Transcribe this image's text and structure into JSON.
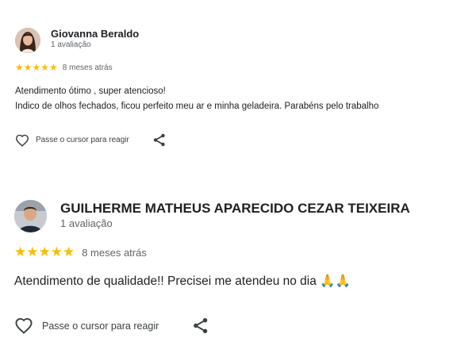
{
  "reviews": [
    {
      "author": "Giovanna Beraldo",
      "review_count": "1 avaliação",
      "stars": "★★★★★",
      "rating": 5,
      "date": "8 meses atrás",
      "text_lines": [
        "Atendimento ótimo , super atencioso!",
        "Indico de olhos fechados, ficou perfeito meu ar e minha geladeira. Parabéns pelo trabalho"
      ],
      "react_label": "Passe o cursor para reagir"
    },
    {
      "author": "GUILHERME MATHEUS APARECIDO CEZAR TEIXEIRA",
      "review_count": "1 avaliação",
      "stars": "★★★★★",
      "rating": 5,
      "date": "8 meses atrás",
      "text": "Atendimento de qualidade!! Precisei me atendeu no dia 🙏🙏",
      "react_label": "Passe o cursor para reagir"
    }
  ],
  "icons": {
    "heart": "heart-outline-icon",
    "share": "share-icon"
  },
  "colors": {
    "star": "#fbbc04",
    "text": "#202124",
    "muted": "#5f6368"
  }
}
